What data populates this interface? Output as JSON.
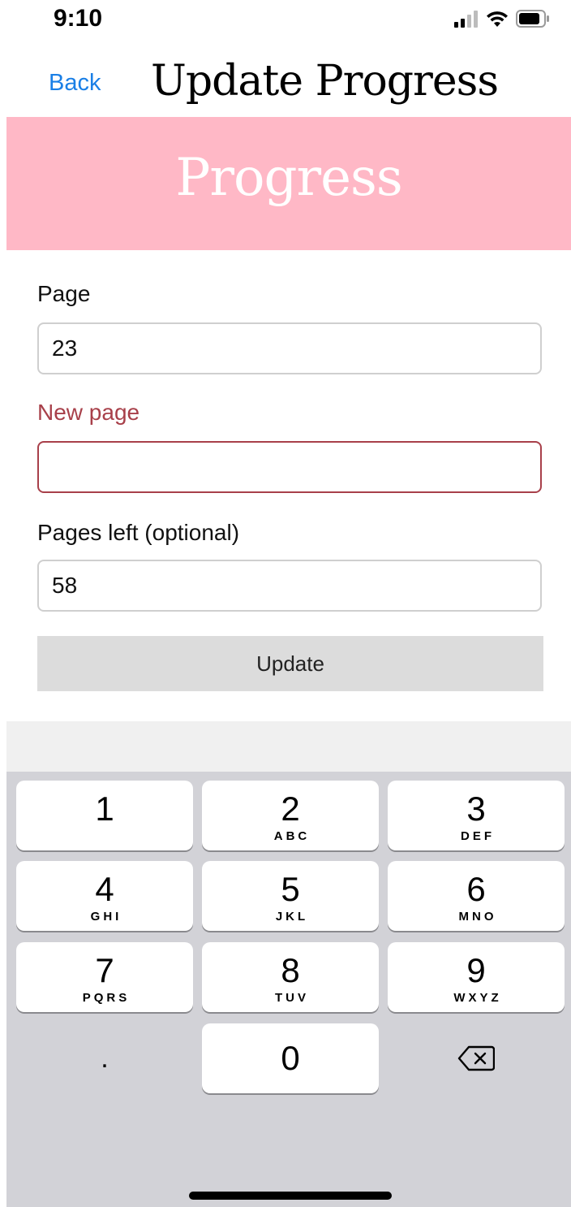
{
  "status_bar": {
    "time": "9:10",
    "icons": [
      "cellular-signal-icon",
      "wifi-icon",
      "battery-icon"
    ]
  },
  "nav": {
    "back_label": "Back",
    "title": "Update Progress"
  },
  "banner": {
    "title": "Progress"
  },
  "form": {
    "page_label": "Page",
    "page_value": "23",
    "new_page_label": "New page",
    "new_page_value": "",
    "pages_left_label": "Pages left (optional)",
    "pages_left_value": "58",
    "update_label": "Update"
  },
  "keyboard": {
    "keys": [
      {
        "digit": "1",
        "letters": ""
      },
      {
        "digit": "2",
        "letters": "ABC"
      },
      {
        "digit": "3",
        "letters": "DEF"
      },
      {
        "digit": "4",
        "letters": "GHI"
      },
      {
        "digit": "5",
        "letters": "JKL"
      },
      {
        "digit": "6",
        "letters": "MNO"
      },
      {
        "digit": "7",
        "letters": "PQRS"
      },
      {
        "digit": "8",
        "letters": "TUV"
      },
      {
        "digit": "9",
        "letters": "WXYZ"
      },
      {
        "digit": ".",
        "letters": ""
      },
      {
        "digit": "0",
        "letters": ""
      }
    ],
    "delete_icon": "delete-backspace-icon"
  },
  "colors": {
    "accent_blue": "#1a7fe6",
    "banner_pink": "#ffb8c6",
    "error_red": "#a8404a",
    "button_gray": "#dcdcdc",
    "keyboard_gray": "#d2d2d7"
  }
}
